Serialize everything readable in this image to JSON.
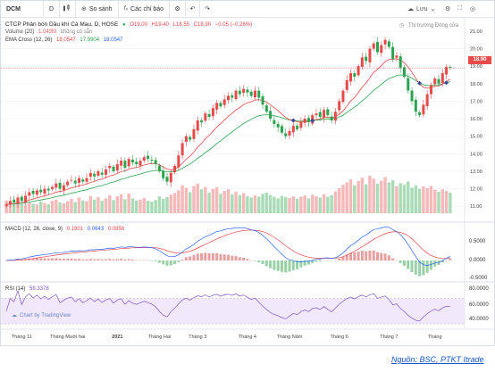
{
  "toolbar": {
    "symbol": "DCM",
    "interval": "D",
    "compare_label": "So sánh",
    "indicators_label": "Các chỉ báo",
    "save_label": "Lưu"
  },
  "header": {
    "title": "CTCP Phân bón Dầu khí Cà Mau, D, HOSE",
    "ohlc": {
      "o": "O19.00",
      "h": "H19.40",
      "l": "L18.55",
      "c": "C18.90"
    },
    "change": "−0.05 (−0.26%)",
    "volume_label": "Volume (20)",
    "volume_value": "1.049M",
    "volume_na": "không có sẵn",
    "ema_label": "EMA Cross (12, 26)",
    "ema_values": [
      "18.0547",
      "17.9904",
      "18.0547"
    ],
    "market_status": "Thị trường Đóng cửa",
    "last_price": "18.90"
  },
  "macd": {
    "label": "MACD (12, 26, close, 9)",
    "values": [
      "0.1901",
      "0.0643",
      "0.0858"
    ],
    "axis": [
      "0.5000",
      "0.0000",
      "-0.5000"
    ]
  },
  "rsi": {
    "label": "RSI (14)",
    "value": "58.3378",
    "axis": [
      "80.0000",
      "60.0000",
      "40.0000"
    ]
  },
  "credit": "Chart by TradingView",
  "source": "Nguồn: BSC, PTKT Itrade",
  "colors": {
    "up": "#e84a4a",
    "down": "#2ca44f",
    "ema_fast": "#e84a4a",
    "ema_slow": "#2ca44f",
    "macd": "#2962ff",
    "signal": "#e84a4a",
    "rsi": "#7e57c2"
  },
  "chart_data": {
    "type": "candlestick",
    "title": "CTCP Phân bón Dầu khí Cà Mau, D, HOSE",
    "y_ticks": [
      21.0,
      20.0,
      19.0,
      18.0,
      17.0,
      16.0,
      15.0,
      14.0,
      13.0,
      12.0,
      11.0
    ],
    "ylim": [
      10.6,
      21.2
    ],
    "x_tick_labels": [
      "Tháng 11",
      "Tháng Mười hai",
      "2021",
      "Tháng Hai",
      "Tháng 3",
      "Tháng 4",
      "Tháng Năm",
      "Tháng 6",
      "Tháng 7",
      "Tháng"
    ],
    "close": [
      11.1,
      11.3,
      11.2,
      11.5,
      11.3,
      11.6,
      11.8,
      11.7,
      11.9,
      11.8,
      12.0,
      11.9,
      12.1,
      12.3,
      12.0,
      12.2,
      12.4,
      12.5,
      12.3,
      12.6,
      12.4,
      12.6,
      12.9,
      12.7,
      13.0,
      12.8,
      13.1,
      13.3,
      13.0,
      13.4,
      13.6,
      13.2,
      13.7,
      13.5,
      13.4,
      13.6,
      13.8,
      13.7,
      13.6,
      13.4,
      13.0,
      12.6,
      12.4,
      12.9,
      13.3,
      13.9,
      14.6,
      15.0,
      14.8,
      15.4,
      15.9,
      15.8,
      16.3,
      16.1,
      16.6,
      16.9,
      16.7,
      17.1,
      17.3,
      17.2,
      17.6,
      17.4,
      17.7,
      17.5,
      17.3,
      17.6,
      17.2,
      16.8,
      16.4,
      16.0,
      15.7,
      15.5,
      15.2,
      15.0,
      15.3,
      15.6,
      15.4,
      15.8,
      16.0,
      15.8,
      16.2,
      16.3,
      16.1,
      16.5,
      16.2,
      15.9,
      16.4,
      17.0,
      17.6,
      18.2,
      18.6,
      18.4,
      19.0,
      19.5,
      19.3,
      20.0,
      20.3,
      19.8,
      20.2,
      20.5,
      20.1,
      19.4,
      19.6,
      18.9,
      18.4,
      17.6,
      17.0,
      16.4,
      16.2,
      16.8,
      17.4,
      17.9,
      18.3,
      18.0,
      18.6,
      18.95,
      18.9
    ],
    "volume": [
      3.1,
      2.4,
      2.0,
      2.7,
      2.2,
      1.9,
      2.6,
      2.3,
      2.1,
      2.8,
      2.5,
      2.2,
      3.0,
      3.3,
      2.6,
      2.4,
      2.9,
      3.5,
      2.7,
      3.8,
      3.1,
      2.9,
      4.2,
      3.3,
      3.9,
      3.0,
      3.6,
      4.4,
      3.2,
      4.1,
      4.6,
      3.4,
      4.8,
      3.6,
      3.1,
      3.3,
      3.7,
      3.0,
      2.8,
      3.2,
      4.1,
      3.5,
      3.9,
      4.5,
      4.9,
      5.6,
      6.8,
      6.2,
      5.1,
      6.6,
      7.2,
      5.8,
      6.4,
      5.0,
      5.9,
      6.3,
      4.7,
      5.4,
      5.8,
      4.6,
      5.2,
      4.4,
      4.9,
      4.1,
      3.8,
      4.3,
      4.0,
      4.7,
      5.0,
      4.4,
      4.0,
      3.6,
      4.2,
      3.9,
      3.7,
      4.1,
      3.5,
      4.0,
      4.3,
      3.6,
      4.5,
      4.1,
      3.8,
      4.6,
      4.0,
      4.4,
      5.3,
      6.1,
      6.9,
      7.5,
      8.2,
      6.8,
      7.8,
      8.6,
      7.0,
      9.1,
      8.4,
      7.2,
      7.9,
      8.8,
      7.5,
      8.0,
      6.6,
      7.3,
      6.9,
      7.7,
      6.2,
      6.8,
      5.9,
      6.5,
      6.1,
      6.6,
      5.7,
      5.2,
      5.8,
      5.4,
      5.0
    ],
    "volume_unit": "M",
    "macd_axis": [
      -0.5,
      0.0,
      0.5
    ],
    "rsi_axis": [
      40,
      60,
      80
    ],
    "series": [
      {
        "name": "EMA 12"
      },
      {
        "name": "EMA 26"
      },
      {
        "name": "MACD"
      },
      {
        "name": "Signal"
      },
      {
        "name": "RSI"
      }
    ]
  }
}
